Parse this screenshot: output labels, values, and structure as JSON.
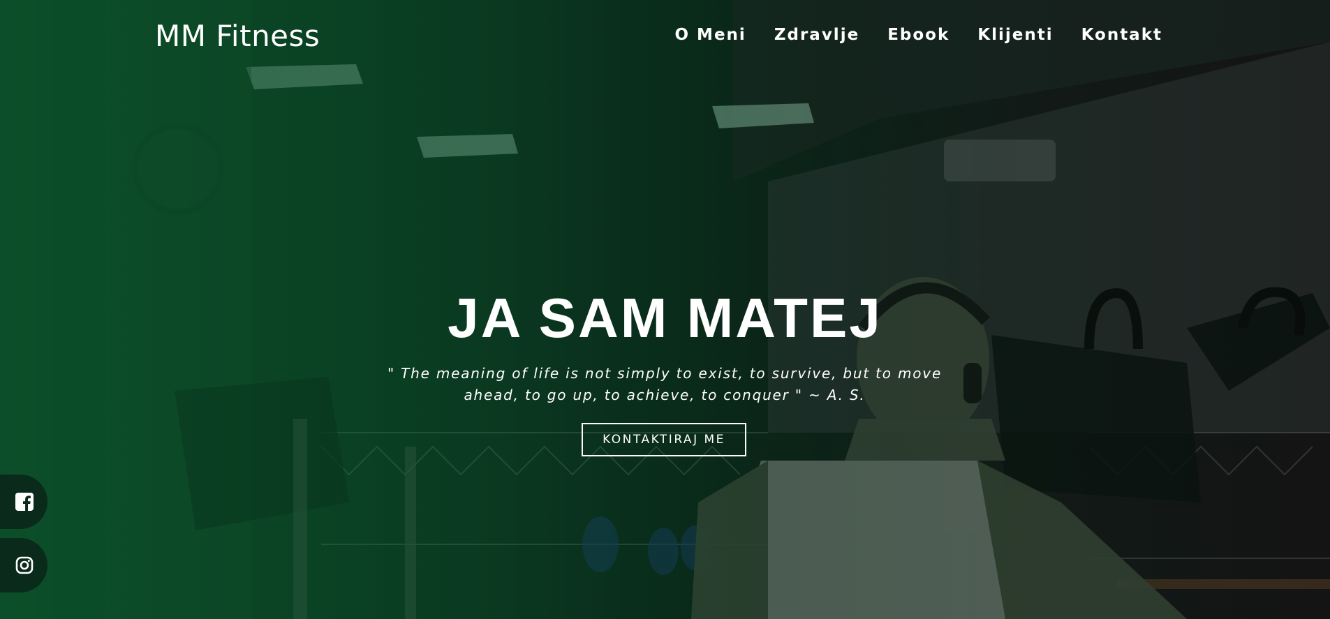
{
  "header": {
    "brand": "MM Fitness",
    "nav": [
      {
        "label": "O Meni"
      },
      {
        "label": "Zdravlje"
      },
      {
        "label": "Ebook"
      },
      {
        "label": "Klijenti"
      },
      {
        "label": "Kontakt"
      }
    ]
  },
  "hero": {
    "title": "JA SAM MATEJ",
    "quote": "\" The meaning of life is not simply to exist, to survive, but to move ahead, to go up, to achieve, to conquer \" ~ A. S.",
    "cta_label": "KONTAKTIRAJ ME",
    "background_image": "gym-photo-man-with-headphones"
  },
  "social": [
    {
      "icon": "facebook-icon"
    },
    {
      "icon": "instagram-icon"
    }
  ],
  "colors": {
    "overlay_green": "#0e4a2a",
    "text": "#ffffff",
    "social_bg": "#0a2a1c"
  }
}
